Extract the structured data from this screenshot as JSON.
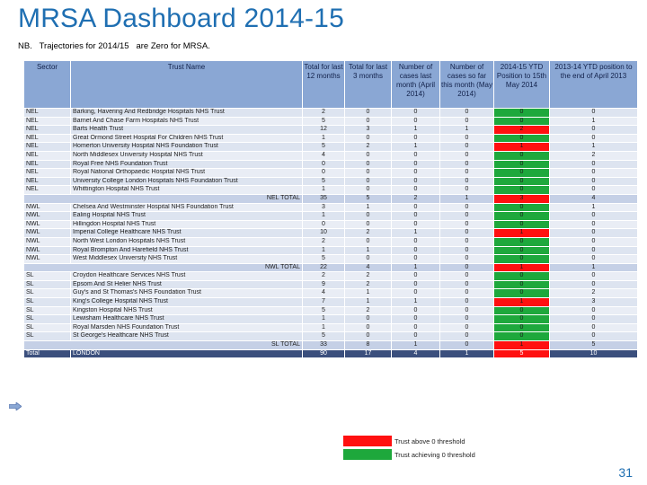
{
  "title": "MRSA Dashboard 2014-15",
  "note": "NB.   Trajectories for 2014/15   are Zero for MRSA.",
  "columns": [
    "Sector",
    "Trust Name",
    "Total for last 12 months",
    "Total for last 3 months",
    "Number of cases last month (April 2014)",
    "Number of cases so far this month (May 2014)",
    "2014-15 YTD Position to 15th May 2014",
    "2013-14 YTD position to the end of April 2013"
  ],
  "groups": [
    {
      "rows": [
        {
          "sector": "NEL",
          "trust": "Barking, Havering And Redbridge Hospitals NHS Trust",
          "v12": "2",
          "v3": "0",
          "apr": "0",
          "may": "0",
          "ytd": "0",
          "ytd_status": "green",
          "prev": "0"
        },
        {
          "sector": "NEL",
          "trust": "Barnet And Chase Farm Hospitals NHS Trust",
          "v12": "5",
          "v3": "0",
          "apr": "0",
          "may": "0",
          "ytd": "0",
          "ytd_status": "green",
          "prev": "1"
        },
        {
          "sector": "NEL",
          "trust": "Barts Health Trust",
          "v12": "12",
          "v3": "3",
          "apr": "1",
          "may": "1",
          "ytd": "2",
          "ytd_status": "red",
          "prev": "0"
        },
        {
          "sector": "NEL",
          "trust": "Great Ormond Street Hospital For Children NHS Trust",
          "v12": "1",
          "v3": "0",
          "apr": "0",
          "may": "0",
          "ytd": "0",
          "ytd_status": "green",
          "prev": "0"
        },
        {
          "sector": "NEL",
          "trust": "Homerton University Hospital NHS Foundation Trust",
          "v12": "5",
          "v3": "2",
          "apr": "1",
          "may": "0",
          "ytd": "1",
          "ytd_status": "red",
          "prev": "1"
        },
        {
          "sector": "NEL",
          "trust": "North Middlesex University Hospital NHS Trust",
          "v12": "4",
          "v3": "0",
          "apr": "0",
          "may": "0",
          "ytd": "0",
          "ytd_status": "green",
          "prev": "2"
        },
        {
          "sector": "NEL",
          "trust": "Royal Free NHS Foundation Trust",
          "v12": "0",
          "v3": "0",
          "apr": "0",
          "may": "0",
          "ytd": "0",
          "ytd_status": "green",
          "prev": "0"
        },
        {
          "sector": "NEL",
          "trust": "Royal National Orthopaedic Hospital NHS Trust",
          "v12": "0",
          "v3": "0",
          "apr": "0",
          "may": "0",
          "ytd": "0",
          "ytd_status": "green",
          "prev": "0"
        },
        {
          "sector": "NEL",
          "trust": "University College London Hospitals NHS Foundation Trust",
          "v12": "5",
          "v3": "0",
          "apr": "0",
          "may": "0",
          "ytd": "0",
          "ytd_status": "green",
          "prev": "0"
        },
        {
          "sector": "NEL",
          "trust": "Whittington Hospital NHS Trust",
          "v12": "1",
          "v3": "0",
          "apr": "0",
          "may": "0",
          "ytd": "0",
          "ytd_status": "green",
          "prev": "0"
        }
      ],
      "total": {
        "label": "NEL TOTAL",
        "v12": "35",
        "v3": "5",
        "apr": "2",
        "may": "1",
        "ytd": "3",
        "ytd_status": "red",
        "prev": "4"
      }
    },
    {
      "rows": [
        {
          "sector": "NWL",
          "trust": "Chelsea And Westminster Hospital NHS Foundation Trust",
          "v12": "3",
          "v3": "1",
          "apr": "0",
          "may": "0",
          "ytd": "0",
          "ytd_status": "green",
          "prev": "1"
        },
        {
          "sector": "NWL",
          "trust": "Ealing Hospital NHS Trust",
          "v12": "1",
          "v3": "0",
          "apr": "0",
          "may": "0",
          "ytd": "0",
          "ytd_status": "green",
          "prev": "0"
        },
        {
          "sector": "NWL",
          "trust": "Hillingdon Hospital NHS Trust",
          "v12": "0",
          "v3": "0",
          "apr": "0",
          "may": "0",
          "ytd": "0",
          "ytd_status": "green",
          "prev": "0"
        },
        {
          "sector": "NWL",
          "trust": "Imperial College Healthcare NHS Trust",
          "v12": "10",
          "v3": "2",
          "apr": "1",
          "may": "0",
          "ytd": "1",
          "ytd_status": "red",
          "prev": "0"
        },
        {
          "sector": "NWL",
          "trust": "North West London Hospitals NHS Trust",
          "v12": "2",
          "v3": "0",
          "apr": "0",
          "may": "0",
          "ytd": "0",
          "ytd_status": "green",
          "prev": "0"
        },
        {
          "sector": "NWL",
          "trust": "Royal Brompton And Harefield NHS Trust",
          "v12": "1",
          "v3": "1",
          "apr": "0",
          "may": "0",
          "ytd": "0",
          "ytd_status": "green",
          "prev": "0"
        },
        {
          "sector": "NWL",
          "trust": "West Middlesex University NHS Trust",
          "v12": "5",
          "v3": "0",
          "apr": "0",
          "may": "0",
          "ytd": "0",
          "ytd_status": "green",
          "prev": "0"
        }
      ],
      "total": {
        "label": "NWL TOTAL",
        "v12": "22",
        "v3": "4",
        "apr": "1",
        "may": "0",
        "ytd": "1",
        "ytd_status": "red",
        "prev": "1"
      }
    },
    {
      "rows": [
        {
          "sector": "SL",
          "trust": "Croydon Healthcare Services NHS Trust",
          "v12": "2",
          "v3": "2",
          "apr": "0",
          "may": "0",
          "ytd": "0",
          "ytd_status": "green",
          "prev": "0"
        },
        {
          "sector": "SL",
          "trust": "Epsom And St Helier NHS Trust",
          "v12": "9",
          "v3": "2",
          "apr": "0",
          "may": "0",
          "ytd": "0",
          "ytd_status": "green",
          "prev": "0"
        },
        {
          "sector": "SL",
          "trust": "Guy's and St Thomas's NHS Foundation Trust",
          "v12": "4",
          "v3": "1",
          "apr": "0",
          "may": "0",
          "ytd": "0",
          "ytd_status": "green",
          "prev": "2"
        },
        {
          "sector": "SL",
          "trust": "King's College Hospital NHS Trust",
          "v12": "7",
          "v3": "1",
          "apr": "1",
          "may": "0",
          "ytd": "1",
          "ytd_status": "red",
          "prev": "3"
        },
        {
          "sector": "SL",
          "trust": "Kingston Hospital NHS Trust",
          "v12": "5",
          "v3": "2",
          "apr": "0",
          "may": "0",
          "ytd": "0",
          "ytd_status": "green",
          "prev": "0"
        },
        {
          "sector": "SL",
          "trust": "Lewisham Healthcare NHS Trust",
          "v12": "1",
          "v3": "0",
          "apr": "0",
          "may": "0",
          "ytd": "0",
          "ytd_status": "green",
          "prev": "0"
        },
        {
          "sector": "SL",
          "trust": "Royal Marsden NHS Foundation Trust",
          "v12": "1",
          "v3": "0",
          "apr": "0",
          "may": "0",
          "ytd": "0",
          "ytd_status": "green",
          "prev": "0"
        },
        {
          "sector": "SL",
          "trust": "St George's Healthcare NHS Trust",
          "v12": "5",
          "v3": "0",
          "apr": "0",
          "may": "0",
          "ytd": "0",
          "ytd_status": "green",
          "prev": "0"
        }
      ],
      "total": {
        "label": "SL TOTAL",
        "v12": "33",
        "v3": "8",
        "apr": "1",
        "may": "0",
        "ytd": "1",
        "ytd_status": "red",
        "prev": "5"
      }
    }
  ],
  "grand_total": {
    "sector": "Total",
    "trust": "LONDON",
    "v12": "90",
    "v3": "17",
    "apr": "4",
    "may": "1",
    "ytd": "5",
    "ytd_status": "red",
    "prev": "10"
  },
  "legend": [
    {
      "label": "Trust above 0 threshold",
      "color": "#ff1010"
    },
    {
      "label": "Trust achieving 0 threshold",
      "color": "#1ea83c"
    }
  ],
  "page_number": "31"
}
